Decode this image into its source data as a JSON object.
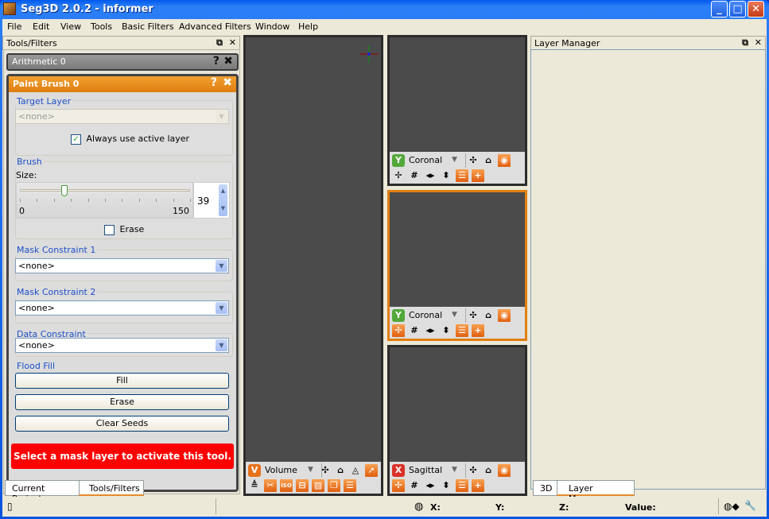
{
  "window": {
    "title": "Seg3D  2.0.2 - informer",
    "controls": {
      "minimize": "_",
      "maximize": "□",
      "close": "✕"
    }
  },
  "menu": [
    "File",
    "Edit",
    "View",
    "Tools",
    "Basic Filters",
    "Advanced Filters",
    "Window",
    "Help"
  ],
  "left_dock": {
    "title": "Tools/Filters",
    "float_icon": "⧉",
    "close_icon": "✕",
    "collapsed_tool": {
      "title": "Arithmetic 0",
      "help": "?",
      "close": "✖"
    },
    "active_tool": {
      "title": "Paint Brush 0",
      "help": "?",
      "close": "✖",
      "target_layer": {
        "label": "Target Layer",
        "value": "<none>",
        "always_active_label": "Always use active layer",
        "always_active_checked": true
      },
      "brush": {
        "label": "Brush",
        "size_label": "Size:",
        "size_value": "39",
        "min_label": "0",
        "max_label": "150",
        "min": 0,
        "max": 150,
        "value": 39,
        "erase_label": "Erase",
        "erase_checked": false
      },
      "mask_constraint_1": {
        "label": "Mask Constraint 1",
        "value": "<none>"
      },
      "mask_constraint_2": {
        "label": "Mask Constraint 2",
        "value": "<none>"
      },
      "data_constraint": {
        "label": "Data Constraint",
        "value": "<none>"
      },
      "flood_fill": {
        "label": "Flood Fill",
        "fill": "Fill",
        "erase": "Erase",
        "clear_seeds": "Clear Seeds"
      },
      "warning": "Select a mask layer to activate this tool."
    },
    "tabs": [
      "Current Project",
      "Tools/Filters"
    ],
    "active_tab": "Tools/Filters"
  },
  "viewers": [
    {
      "name": "Volume",
      "badge": "V",
      "badge_color": "#e8721c",
      "active": false
    },
    {
      "name": "Coronal",
      "badge": "Y",
      "badge_color": "#52a83a",
      "active": false
    },
    {
      "name": "Coronal",
      "badge": "Y",
      "badge_color": "#52a83a",
      "active": true
    },
    {
      "name": "Sagittal",
      "badge": "X",
      "badge_color": "#d8322a",
      "active": false
    }
  ],
  "right_dock": {
    "title": "Layer Manager",
    "float_icon": "⧉",
    "close_icon": "✕",
    "tabs": [
      "3D",
      "Layer Manager"
    ],
    "active_tab": "Layer Manager"
  },
  "status": {
    "x_label": "X:",
    "y_label": "Y:",
    "z_label": "Z:",
    "value_label": "Value:"
  },
  "colors": {
    "accent": "#e8821c",
    "warning": "#ff0000",
    "group_label": "#1e4fc8"
  }
}
